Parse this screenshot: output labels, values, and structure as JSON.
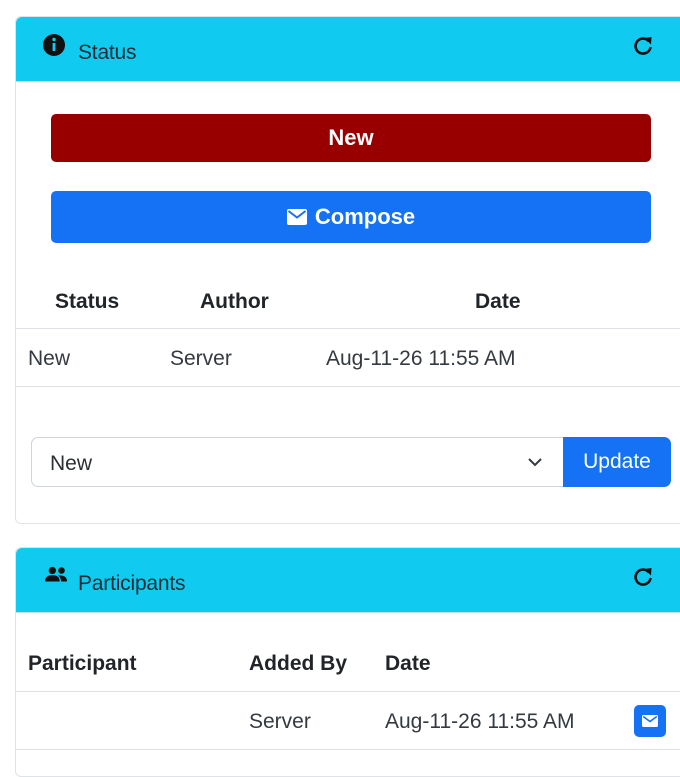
{
  "status_card": {
    "title": "Status",
    "header_icon": "info-circle-icon",
    "refresh_icon": "refresh-icon",
    "new_button": "New",
    "compose_button": "Compose",
    "table": {
      "headers": [
        "Status",
        "Author",
        "Date"
      ],
      "rows": [
        {
          "status": "New",
          "author": "Server",
          "date": "Aug-11-26 11:55 AM"
        }
      ]
    },
    "select_value": "New",
    "update_button": "Update",
    "colors": {
      "header": "#11caf0",
      "new": "#980000",
      "primary": "#1572f5"
    }
  },
  "participants_card": {
    "title": "Participants",
    "header_icon": "people-icon",
    "refresh_icon": "refresh-icon",
    "table": {
      "headers": [
        "Participant",
        "Added By",
        "Date"
      ],
      "rows": [
        {
          "participant": "",
          "added_by": "Server",
          "date": "Aug-11-26 11:55 AM"
        }
      ]
    },
    "row_action_icon": "envelope-icon"
  }
}
